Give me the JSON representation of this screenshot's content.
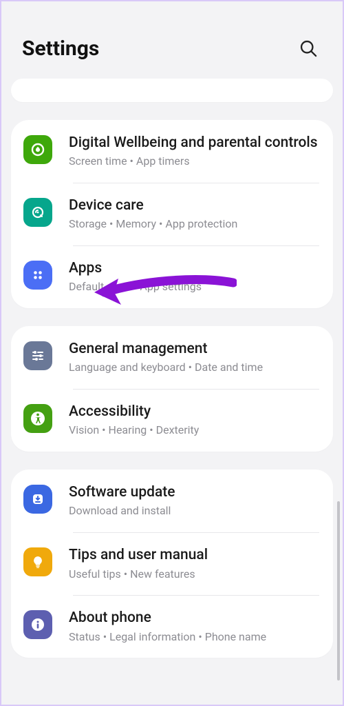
{
  "header": {
    "title": "Settings"
  },
  "groups": [
    {
      "items": [
        {
          "key": "wellbeing",
          "title": "Digital Wellbeing and parental controls",
          "sub": "Screen time  •  App timers"
        },
        {
          "key": "devicecare",
          "title": "Device care",
          "sub": "Storage  •  Memory  •  App protection"
        },
        {
          "key": "apps",
          "title": "Apps",
          "sub": "Default apps  •  App settings"
        }
      ]
    },
    {
      "items": [
        {
          "key": "general",
          "title": "General management",
          "sub": "Language and keyboard  •  Date and time"
        },
        {
          "key": "accessibility",
          "title": "Accessibility",
          "sub": "Vision  •  Hearing  •  Dexterity"
        }
      ]
    },
    {
      "items": [
        {
          "key": "software",
          "title": "Software update",
          "sub": "Download and install"
        },
        {
          "key": "tips",
          "title": "Tips and user manual",
          "sub": "Useful tips  •  New features"
        },
        {
          "key": "about",
          "title": "About phone",
          "sub": "Status  •  Legal information  •  Phone name"
        }
      ]
    }
  ],
  "annotation": {
    "target": "apps",
    "color": "#8a13d6"
  }
}
